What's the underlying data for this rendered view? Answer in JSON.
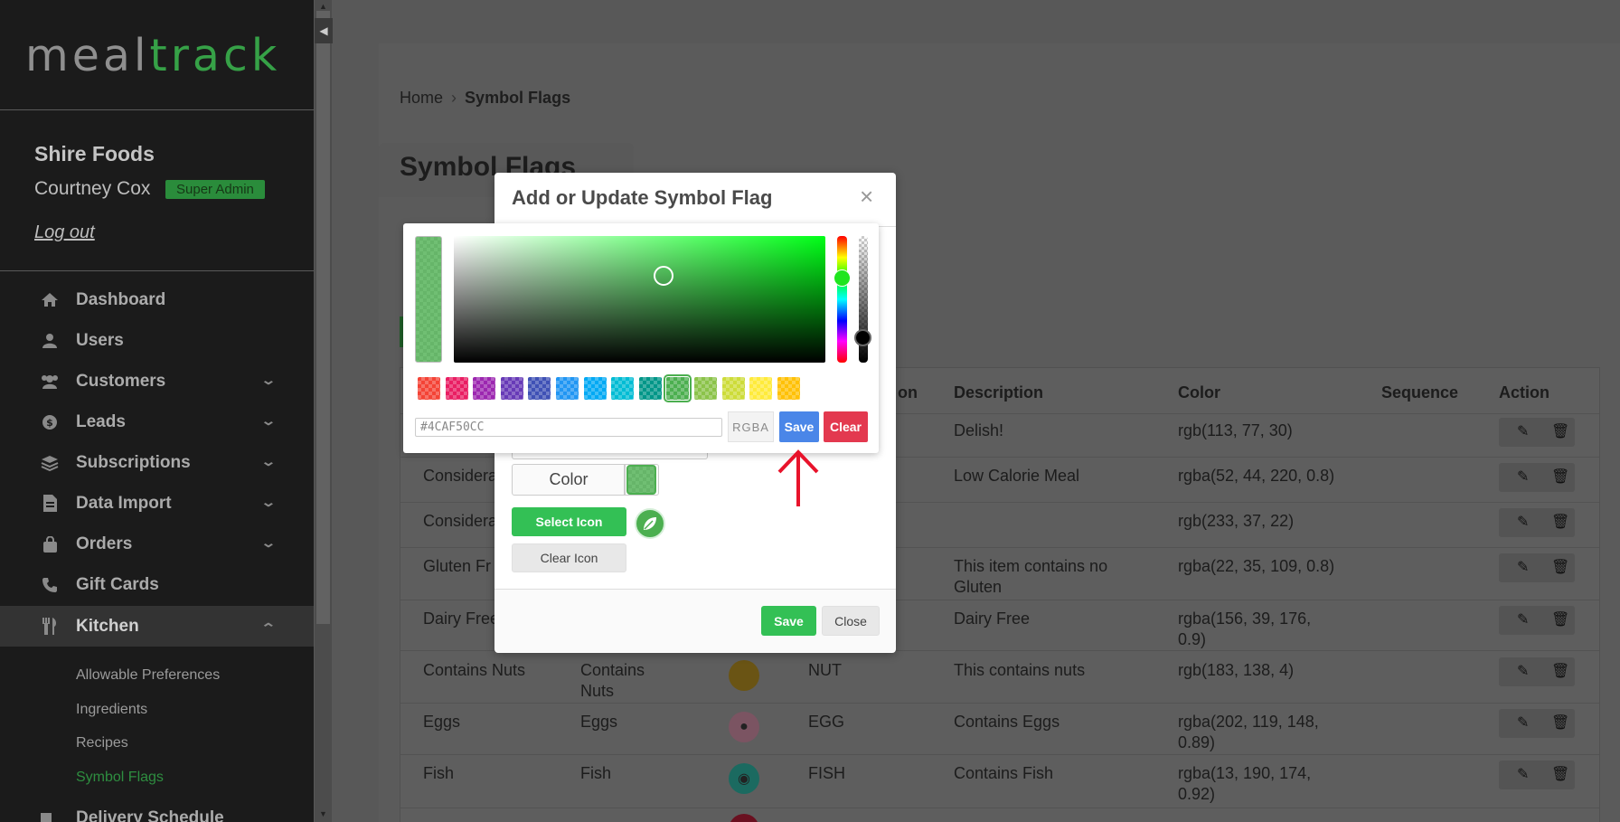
{
  "app": {
    "logo_part1": "meal",
    "logo_part2": "track"
  },
  "account": {
    "company": "Shire Foods",
    "user": "Courtney Cox",
    "role_badge": "Super Admin",
    "logout": "Log out"
  },
  "nav": {
    "items": [
      {
        "label": "Dashboard",
        "icon": "home-icon"
      },
      {
        "label": "Users",
        "icon": "user-icon"
      },
      {
        "label": "Customers",
        "icon": "users-icon"
      },
      {
        "label": "Leads",
        "icon": "dollar-icon"
      },
      {
        "label": "Subscriptions",
        "icon": "layers-icon"
      },
      {
        "label": "Data Import",
        "icon": "file-import-icon"
      },
      {
        "label": "Orders",
        "icon": "shopping-bag-icon"
      },
      {
        "label": "Gift Cards",
        "icon": "phone-icon"
      },
      {
        "label": "Kitchen",
        "icon": "utensils-icon"
      }
    ],
    "kitchen_sub": [
      "Allowable Preferences",
      "Ingredients",
      "Recipes",
      "Symbol Flags"
    ],
    "next_cutoff": "Delivery Schedule"
  },
  "breadcrumb": {
    "home": "Home",
    "separator": "›",
    "current": "Symbol Flags"
  },
  "page_title": "Symbol Flags",
  "table": {
    "headers": {
      "description": "Description",
      "color": "Color",
      "sequence": "Sequence",
      "action": "Action",
      "code_partial": "on"
    },
    "rows": [
      {
        "name": "",
        "display": "",
        "code": "",
        "description": "Delish!",
        "color": "rgb(113, 77, 30)"
      },
      {
        "name": "Considera",
        "display": "",
        "code": "",
        "description": "Low Calorie Meal",
        "color": "rgba(52, 44, 220, 0.8)"
      },
      {
        "name": "Considera",
        "display": "",
        "code": "",
        "description": "",
        "color": "rgb(233, 37, 22)"
      },
      {
        "name": "Gluten Fr",
        "display": "",
        "code": "",
        "description": "This item contains no Gluten",
        "color": "rgba(22, 35, 109, 0.8)"
      },
      {
        "name": "Dairy Free",
        "display": "",
        "code": "",
        "description": "Dairy Free",
        "color": "rgba(156, 39, 176, 0.9)"
      },
      {
        "name": "Contains Nuts",
        "display": "Contains Nuts",
        "code": "NUT",
        "description": "This contains nuts",
        "color": "rgb(183, 138, 4)"
      },
      {
        "name": "Eggs",
        "display": "Eggs",
        "code": "EGG",
        "description": "Contains Eggs",
        "color": "rgba(202, 119, 148, 0.89)"
      },
      {
        "name": "Fish",
        "display": "Fish",
        "code": "FISH",
        "description": "Contains Fish",
        "color": "rgba(13, 190, 174, 0.92)"
      }
    ]
  },
  "modal": {
    "title": "Add or Update Symbol Flag",
    "close_symbol": "×",
    "color_label": "Color",
    "select_icon": "Select Icon",
    "clear_icon": "Clear Icon",
    "save": "Save",
    "close": "Close"
  },
  "picker": {
    "hex_value": "#4CAF50CC",
    "mode": "RGBA",
    "save": "Save",
    "clear": "Clear",
    "current_color": "#4CAF50",
    "swatches": [
      "#F44336",
      "#E91E63",
      "#9C27B0",
      "#673AB7",
      "#3F51B5",
      "#2196F3",
      "#03A9F4",
      "#00BCD4",
      "#009688",
      "#4CAF50",
      "#8BC34A",
      "#CDDC39",
      "#FFEB3B",
      "#FFC107"
    ],
    "selected_swatch": 9
  },
  "colors": {
    "accent_green": "#33c055",
    "brand_green": "#36a147",
    "save_blue": "#4a86e8",
    "clear_red": "#e3394f",
    "arrow_red": "#e8132b"
  }
}
